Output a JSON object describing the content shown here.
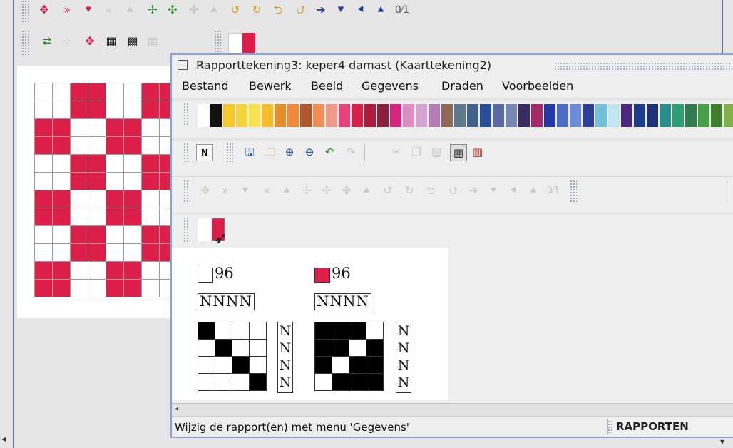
{
  "window": {
    "title": "Rapporttekening3: keper4 damast (Kaarttekening2)"
  },
  "menu": [
    {
      "pre": "",
      "u": "B",
      "post": "estand"
    },
    {
      "pre": "Be",
      "u": "w",
      "post": "erk"
    },
    {
      "pre": "Beel",
      "u": "d",
      "post": ""
    },
    {
      "pre": "",
      "u": "G",
      "post": "egevens"
    },
    {
      "pre": "D",
      "u": "r",
      "post": "aden"
    },
    {
      "pre": "",
      "u": "V",
      "post": "oorbeelden"
    }
  ],
  "palette_colors": [
    "#ffffff",
    "#111111",
    "#f7c928",
    "#f5d33b",
    "#f7e14e",
    "#f6bc2a",
    "#e58e29",
    "#f08a3a",
    "#b5562a",
    "#f38b52",
    "#f29a8a",
    "#e7427c",
    "#d8204b",
    "#b01a3c",
    "#8c1e3f",
    "#d5257e",
    "#e08cc4",
    "#d3a6d2",
    "#b47db8",
    "#8f6a5a",
    "#5d7a8c",
    "#42628c",
    "#2a4f9a",
    "#5a6aa0",
    "#7886b0",
    "#3c2a62",
    "#a72b6b",
    "#2538a8",
    "#4a6cc7",
    "#6c8ad8",
    "#2b3e9c",
    "#6fc1d9",
    "#c0e6f0",
    "#4b2880",
    "#1c3b8f",
    "#1f2f7a",
    "#2a8f8c",
    "#2e9e74",
    "#2f7d4e",
    "#45a048",
    "#3f7e2e",
    "#7fb04c"
  ],
  "toolbar": {
    "new_label": "N",
    "transform_ratio_label": "0⁄1"
  },
  "bg_toolbar_ratio_label": "0⁄1",
  "colors": {
    "accent_red": "#dc1f48",
    "frame_blue": "#8ea2c9"
  },
  "bg_grid_pattern": [
    [
      0,
      0,
      1,
      1,
      0,
      0,
      1,
      1
    ],
    [
      0,
      0,
      1,
      1,
      0,
      0,
      1,
      1
    ],
    [
      1,
      1,
      0,
      0,
      1,
      1,
      0,
      0
    ],
    [
      1,
      1,
      0,
      0,
      1,
      1,
      0,
      0
    ],
    [
      0,
      0,
      1,
      1,
      0,
      0,
      1,
      1
    ],
    [
      0,
      0,
      1,
      1,
      0,
      0,
      1,
      1
    ],
    [
      1,
      1,
      0,
      0,
      1,
      1,
      0,
      0
    ],
    [
      1,
      1,
      0,
      0,
      1,
      1,
      0,
      0
    ],
    [
      0,
      0,
      1,
      1,
      0,
      0,
      1,
      1
    ],
    [
      0,
      0,
      1,
      1,
      0,
      0,
      1,
      1
    ],
    [
      1,
      1,
      0,
      0,
      1,
      1,
      0,
      0
    ],
    [
      1,
      1,
      0,
      0,
      1,
      1,
      0,
      0
    ]
  ],
  "rapports": [
    {
      "swatch": "#ffffff",
      "count": "96",
      "treadling": "NNNN",
      "threading": [
        "N",
        "N",
        "N",
        "N"
      ],
      "matrix": [
        [
          1,
          0,
          0,
          0
        ],
        [
          0,
          1,
          0,
          0
        ],
        [
          0,
          0,
          1,
          0
        ],
        [
          0,
          0,
          0,
          1
        ]
      ]
    },
    {
      "swatch": "#dc1f48",
      "count": "96",
      "treadling": "NNNN",
      "threading": [
        "N",
        "N",
        "N",
        "N"
      ],
      "matrix": [
        [
          1,
          1,
          1,
          0
        ],
        [
          1,
          1,
          0,
          1
        ],
        [
          1,
          0,
          1,
          1
        ],
        [
          0,
          1,
          1,
          1
        ]
      ]
    }
  ],
  "status": {
    "message": "Wijzig de rapport(en) met menu 'Gegevens'",
    "mode": "RAPPORTEN"
  }
}
